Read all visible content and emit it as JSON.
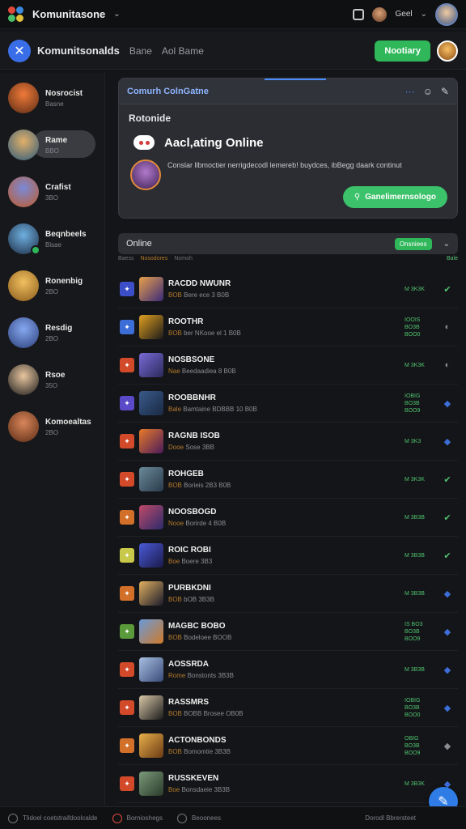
{
  "topbar": {
    "app_title": "Komunitasone",
    "user_label": "Geel"
  },
  "header": {
    "title": "Komunitsonalds",
    "tab1": "Bane",
    "tab2": "Aol Bame",
    "notify_label": "Nootiary"
  },
  "sidebar": {
    "items": [
      {
        "name": "Nosrocist",
        "sub": "Basne",
        "color1": "#f07a3a",
        "color2": "#5a2b14"
      },
      {
        "name": "Rame",
        "sub": "BBO",
        "color1": "#e2b06a",
        "color2": "#2c5a7a",
        "active": true
      },
      {
        "name": "Crafist",
        "sub": "3BO",
        "color1": "#7a8ad8",
        "color2": "#c05a2a"
      },
      {
        "name": "Beqnbeels",
        "sub": "Bisae",
        "color1": "#6fb0e0",
        "color2": "#1c2c44",
        "online": true
      },
      {
        "name": "Ronenbig",
        "sub": "2BO",
        "color1": "#f0c060",
        "color2": "#8a5a1a"
      },
      {
        "name": "Resdig",
        "sub": "2BO",
        "color1": "#86a8f0",
        "color2": "#2b3f7a"
      },
      {
        "name": "Rsoe",
        "sub": "35O",
        "color1": "#e8c6a0",
        "color2": "#1a1a1a"
      },
      {
        "name": "Komoealtas",
        "sub": "2BO",
        "color1": "#d8865a",
        "color2": "#5a2a14"
      }
    ]
  },
  "card": {
    "tab": "Comurh ColnGatne",
    "subtitle": "Rotonide",
    "status_text": "Aacl,ating Online",
    "description": "Conslar llbmoctier nerrigdecodl lemereb! buydces, ibBegg daark continut",
    "action_label": "Ganelimernsologo"
  },
  "online": {
    "label": "Online",
    "badge": "Onsniees"
  },
  "columns": {
    "c1": "Baess",
    "c2": "Nosodores",
    "c3": "Nomoh",
    "c4": "Bale"
  },
  "rows": [
    {
      "icon": "#3d4fc8",
      "avatar1": "#e8a04a",
      "avatar2": "#3a2a7a",
      "name": "RACDD NWUNR",
      "sub_a": "BOB ",
      "sub_b": "Bere ece 3 B0B",
      "stat1": "M 3K3K",
      "stat2": "",
      "stat3": "",
      "act": "✔",
      "act_color": "#4fc26e"
    },
    {
      "icon": "#3d6ed8",
      "avatar1": "#e0a020",
      "avatar2": "#1a1a1a",
      "name": "ROOTHR",
      "sub_a": "BOB ",
      "sub_b": "ber NKooe el 1 B0B",
      "stat1": "IOOIS",
      "stat2": "BO3B",
      "stat3": "BOO0",
      "act": "◐",
      "act_color": "#8a8c92"
    },
    {
      "icon": "#d24a2a",
      "avatar1": "#7a6ad8",
      "avatar2": "#2a2a5a",
      "name": "NOSBSONE",
      "sub_a": "Nae ",
      "sub_b": "Beedaadiea 8 B0B",
      "stat1": "M 3K3K",
      "stat2": "",
      "stat3": "",
      "act": "◐",
      "act_color": "#8a8c92"
    },
    {
      "icon": "#5a4ac8",
      "avatar1": "#3a5a8a",
      "avatar2": "#1a2a44",
      "name": "ROOBBNHR",
      "sub_a": "Bale ",
      "sub_b": "Bamtaine BDBBB 10 B0B",
      "stat1": "IOBIG",
      "stat2": "BO3B",
      "stat3": "BOO9",
      "act": "◆",
      "act_color": "#3d6ed8"
    },
    {
      "icon": "#d24a2a",
      "avatar1": "#e87a2a",
      "avatar2": "#4a1a5a",
      "name": "RAGNB ISOB",
      "sub_a": "Dooe ",
      "sub_b": "Sose 3BB",
      "stat1": "M 3K3",
      "stat2": "",
      "stat3": "",
      "act": "◆",
      "act_color": "#3d6ed8"
    },
    {
      "icon": "#d24a2a",
      "avatar1": "#6a8a9a",
      "avatar2": "#2a3a4a",
      "name": "ROHGEB",
      "sub_a": "BOB ",
      "sub_b": "Borieis 2B3 B0B",
      "stat1": "M 3K3K",
      "stat2": "",
      "stat3": "",
      "act": "✔",
      "act_color": "#4fc26e"
    },
    {
      "icon": "#d2702a",
      "avatar1": "#c04a6a",
      "avatar2": "#2a2a6a",
      "name": "NOOSBOGD",
      "sub_a": "Nooe ",
      "sub_b": "Borirde 4 B0B",
      "stat1": "M 3B3B",
      "stat2": "",
      "stat3": "",
      "act": "✔",
      "act_color": "#4fc26e"
    },
    {
      "icon": "#c8c84a",
      "avatar1": "#4a5ad8",
      "avatar2": "#1a1a4a",
      "name": "ROIC ROBI",
      "sub_a": "Boe ",
      "sub_b": "Boere 3B3",
      "stat1": "M 3B3B",
      "stat2": "",
      "stat3": "",
      "act": "✔",
      "act_color": "#4fc26e"
    },
    {
      "icon": "#d2702a",
      "avatar1": "#e0b060",
      "avatar2": "#1a1a2a",
      "name": "PURBKDNI",
      "sub_a": "BOB ",
      "sub_b": "bOB 3B3B",
      "stat1": "M 3B3B",
      "stat2": "",
      "stat3": "",
      "act": "◆",
      "act_color": "#3d6ed8"
    },
    {
      "icon": "#5a9a3a",
      "avatar1": "#6a9ad8",
      "avatar2": "#d07a2a",
      "name": "MAGBC BOBO",
      "sub_a": "BOB ",
      "sub_b": "Bodeloee BOOB",
      "stat1": "IS BO3",
      "stat2": "BO3B",
      "stat3": "BOO9",
      "act": "◆",
      "act_color": "#3d6ed8"
    },
    {
      "icon": "#d24a2a",
      "avatar1": "#a8c0e0",
      "avatar2": "#3a4a7a",
      "name": "AOSSRDA",
      "sub_a": "Rome ",
      "sub_b": "Bonstonts 3B3B",
      "stat1": "M 3B3B",
      "stat2": "",
      "stat3": "",
      "act": "◆",
      "act_color": "#3d6ed8"
    },
    {
      "icon": "#d24a2a",
      "avatar1": "#d8c8a8",
      "avatar2": "#1a1a1a",
      "name": "RASSMRS",
      "sub_a": "BOB ",
      "sub_b": "BOBB Brosee OB0B",
      "stat1": "IOBIG",
      "stat2": "BO3B",
      "stat3": "BOO0",
      "act": "◆",
      "act_color": "#3d6ed8"
    },
    {
      "icon": "#d2702a",
      "avatar1": "#e8b04a",
      "avatar2": "#6a3a14",
      "name": "ACTONBONDS",
      "sub_a": "BOB ",
      "sub_b": "Bomomtie 3B3B",
      "stat1": "OBIG",
      "stat2": "BO3B",
      "stat3": "BOO9",
      "act": "◆",
      "act_color": "#8a8c92"
    },
    {
      "icon": "#d24a2a",
      "avatar1": "#7a9a7a",
      "avatar2": "#2a3a2a",
      "name": "RUSSKEVEN",
      "sub_a": "Boe ",
      "sub_b": "Bonsdaeie 3B3B",
      "stat1": "M 3B3K",
      "stat2": "",
      "stat3": "",
      "act": "◆",
      "act_color": "#3d6ed8"
    }
  ],
  "bottombar": {
    "left": "Tlidoel coetstraifdoolcalde",
    "middle": "Bornioshegs",
    "mid2": "Beoonees",
    "right": "Dorodl Bbrersteet"
  }
}
